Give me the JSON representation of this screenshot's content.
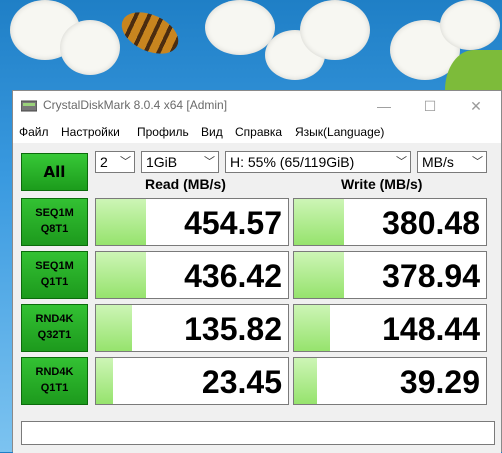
{
  "window": {
    "title": "CrystalDiskMark 8.0.4 x64 [Admin]"
  },
  "window_controls": {
    "minimize": "—",
    "maximize": "☐",
    "close": "✕"
  },
  "menu": [
    "Файл",
    "Настройки",
    "Профиль",
    "Вид",
    "Справка",
    "Язык(Language)"
  ],
  "controls": {
    "all_label": "All",
    "count": "2",
    "size": "1GiB",
    "drive": "H: 55% (65/119GiB)",
    "unit": "MB/s"
  },
  "headers": {
    "read": "Read (MB/s)",
    "write": "Write (MB/s)"
  },
  "tests": [
    {
      "line1": "SEQ1M",
      "line2": "Q8T1",
      "read": "454.57",
      "write": "380.48",
      "read_fill": 0.26,
      "write_fill": 0.26
    },
    {
      "line1": "SEQ1M",
      "line2": "Q1T1",
      "read": "436.42",
      "write": "378.94",
      "read_fill": 0.26,
      "write_fill": 0.26
    },
    {
      "line1": "RND4K",
      "line2": "Q32T1",
      "read": "135.82",
      "write": "148.44",
      "read_fill": 0.19,
      "write_fill": 0.19
    },
    {
      "line1": "RND4K",
      "line2": "Q1T1",
      "read": "23.45",
      "write": "39.29",
      "read_fill": 0.09,
      "write_fill": 0.12
    }
  ],
  "status_text": "",
  "colors": {
    "button_green": "#1d9a1d",
    "bar_green": "#96e36d",
    "wallpaper_sky": "#3a9ae0"
  }
}
